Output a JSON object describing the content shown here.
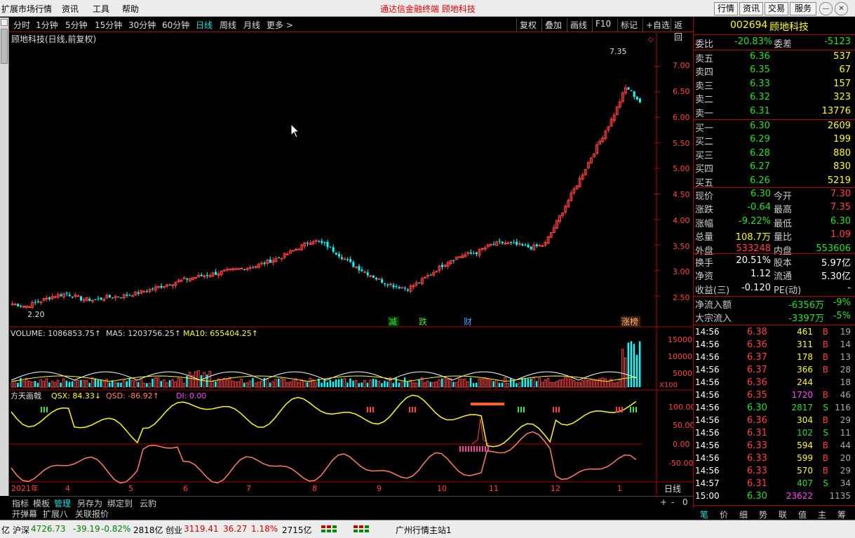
{
  "menubar": {
    "items": [
      "扩展市场行情",
      "资讯",
      "工具",
      "帮助"
    ],
    "title": "通达信金融终端   顾地科技",
    "buttons": [
      "行情",
      "资讯",
      "交易",
      "服务"
    ]
  },
  "timeframes": {
    "items": [
      "分时",
      "1分钟",
      "5分钟",
      "15分钟",
      "30分钟",
      "60分钟",
      "日线",
      "周线",
      "月线",
      "更多 >"
    ],
    "active": "日线"
  },
  "toolbar": {
    "items": [
      "复权",
      "叠加",
      "画线",
      "F10",
      "标记",
      "+自选",
      "返回"
    ]
  },
  "chart": {
    "title": "顾地科技(日线,前复权)",
    "high_label": "7.35",
    "low_label": "2.20",
    "price_axis": [
      "7.00",
      "6.50",
      "6.00",
      "5.50",
      "5.00",
      "4.50",
      "4.00",
      "3.50",
      "3.00",
      "2.50"
    ],
    "markers": [
      {
        "text": "减",
        "color": "#40e040"
      },
      {
        "text": "跌",
        "color": "#40e040"
      },
      {
        "text": "财",
        "color": "#40a0ff"
      },
      {
        "text": "涨榜",
        "color": "#ffb080"
      }
    ],
    "volume_label": "VOLUME: 1086853.75↑",
    "ma5_label": "MA5: 1203756.25↑",
    "ma10_label": "MA10: 655404.25↑",
    "volume_axis": [
      "15000",
      "10000",
      "5000"
    ],
    "volume_unit": "X100",
    "indicator_name": "方天画戟",
    "qsx_label": "QSX: 84.33↓",
    "qsd_label": "QSD: -86.92↑",
    "di_label": "DI: 0.00",
    "indicator_axis": [
      "100.00",
      "50.00",
      "0.00",
      "-50.00"
    ],
    "date_axis": [
      "2021年",
      "4",
      "5",
      "6",
      "7",
      "8",
      "9",
      "10",
      "11",
      "12",
      "1"
    ],
    "period": "日线"
  },
  "chart_data": {
    "type": "candlestick",
    "title": "顾地科技(日线,前复权)",
    "y_range": [
      2.2,
      7.35
    ],
    "x_range": [
      "2021-03",
      "2022-01"
    ],
    "series": [
      {
        "name": "close",
        "values": [
          2.35,
          2.3,
          2.4,
          2.5,
          2.55,
          2.45,
          2.42,
          2.48,
          2.5,
          2.55,
          2.62,
          2.7,
          2.78,
          2.85,
          2.9,
          2.95,
          3.0,
          3.05,
          3.1,
          3.2,
          3.3,
          3.45,
          3.6,
          3.5,
          3.3,
          3.1,
          2.95,
          2.8,
          2.7,
          2.65,
          2.8,
          3.0,
          3.2,
          3.3,
          3.35,
          3.5,
          3.55,
          3.5,
          3.45,
          3.5,
          4.0,
          4.5,
          5.0,
          5.5,
          6.0,
          6.6,
          6.3
        ]
      }
    ],
    "annotations": [
      "7.35",
      "2.20"
    ]
  },
  "right": {
    "code": "002694",
    "name": "顾地科技",
    "weibi_label": "委比",
    "weibi": "-20.83%",
    "weicha_label": "委差",
    "weicha": "-5123",
    "sells": [
      {
        "l": "卖五",
        "p": "6.36",
        "v": "537"
      },
      {
        "l": "卖四",
        "p": "6.35",
        "v": "67"
      },
      {
        "l": "卖三",
        "p": "6.33",
        "v": "157"
      },
      {
        "l": "卖二",
        "p": "6.32",
        "v": "323"
      },
      {
        "l": "卖一",
        "p": "6.31",
        "v": "13776"
      }
    ],
    "buys": [
      {
        "l": "买一",
        "p": "6.30",
        "v": "2609"
      },
      {
        "l": "买二",
        "p": "6.29",
        "v": "199"
      },
      {
        "l": "买三",
        "p": "6.28",
        "v": "880"
      },
      {
        "l": "买四",
        "p": "6.27",
        "v": "830"
      },
      {
        "l": "买五",
        "p": "6.26",
        "v": "5219"
      }
    ],
    "stats": [
      {
        "l1": "现价",
        "v1": "6.30",
        "l2": "今开",
        "v2": "7.30"
      },
      {
        "l1": "涨跌",
        "v1": "-0.64",
        "l2": "最高",
        "v2": "7.35"
      },
      {
        "l1": "涨幅",
        "v1": "-9.22%",
        "l2": "最低",
        "v2": "6.30"
      },
      {
        "l1": "总量",
        "v1": "108.7万",
        "l2": "量比",
        "v2": "1.09"
      },
      {
        "l1": "外盘",
        "v1": "533248",
        "l2": "内盘",
        "v2": "553606"
      }
    ],
    "stats2": [
      {
        "l1": "换手",
        "v1": "20.51%",
        "l2": "股本",
        "v2": "5.97亿"
      },
      {
        "l1": "净资",
        "v1": "1.12",
        "l2": "流通",
        "v2": "5.30亿"
      },
      {
        "l1": "收益(三)",
        "v1": "-0.120",
        "l2": "PE(动)",
        "v2": "-"
      }
    ],
    "flows": [
      {
        "l": "净流入额",
        "v": "-6356万",
        "p": "-9%"
      },
      {
        "l": "大宗流入",
        "v": "-3397万",
        "p": "-5%"
      }
    ],
    "ticks": [
      {
        "t": "14:56",
        "p": "6.38",
        "v": "461",
        "bs": "B",
        "n": "19"
      },
      {
        "t": "14:56",
        "p": "6.36",
        "v": "311",
        "bs": "B",
        "n": "14"
      },
      {
        "t": "14:56",
        "p": "6.37",
        "v": "178",
        "bs": "B",
        "n": "13"
      },
      {
        "t": "14:56",
        "p": "6.37",
        "v": "366",
        "bs": "B",
        "n": "28"
      },
      {
        "t": "14:56",
        "p": "6.36",
        "v": "244",
        "bs": "",
        "n": "18"
      },
      {
        "t": "14:56",
        "p": "6.35",
        "v": "1720",
        "bs": "B",
        "n": "46"
      },
      {
        "t": "14:56",
        "p": "6.30",
        "v": "2817",
        "bs": "S",
        "n": "116"
      },
      {
        "t": "14:56",
        "p": "6.36",
        "v": "304",
        "bs": "B",
        "n": "29"
      },
      {
        "t": "14:56",
        "p": "6.31",
        "v": "102",
        "bs": "S",
        "n": "11"
      },
      {
        "t": "14:56",
        "p": "6.33",
        "v": "594",
        "bs": "B",
        "n": "44"
      },
      {
        "t": "14:56",
        "p": "6.33",
        "v": "599",
        "bs": "B",
        "n": "20"
      },
      {
        "t": "14:56",
        "p": "6.33",
        "v": "570",
        "bs": "B",
        "n": "29"
      },
      {
        "t": "14:57",
        "p": "6.31",
        "v": "407",
        "bs": "S",
        "n": "34"
      },
      {
        "t": "15:00",
        "p": "6.30",
        "v": "23622",
        "bs": "",
        "n": "1135"
      }
    ],
    "tabs": [
      "笔",
      "价",
      "细",
      "势",
      "联",
      "值",
      "主",
      "筹"
    ]
  },
  "bottomtabs": {
    "row1": [
      "指标",
      "模板",
      "管理",
      "另存为",
      "绑定到",
      "云豹"
    ],
    "row2": [
      "开弹幕",
      "扩展八",
      "关联报价"
    ],
    "ctrl": [
      "+",
      "-",
      "0"
    ]
  },
  "status": {
    "prefix": "亿",
    "index1_name": "沪深",
    "index1_val": "4726.73",
    "index1_chg": "-39.19",
    "index1_pct": "-0.82%",
    "index1_amt": "2818亿",
    "index2_name": "创业",
    "index2_val": "3119.41",
    "index2_chg": "36.27",
    "index2_pct": "1.18%",
    "index2_amt": "2715亿",
    "server": "广州行情主站1"
  },
  "colors": {
    "up": "#ff4040",
    "down": "#00ffff",
    "frame": "#b00000",
    "ma5": "#ffffff",
    "ma10": "#ffff00"
  }
}
